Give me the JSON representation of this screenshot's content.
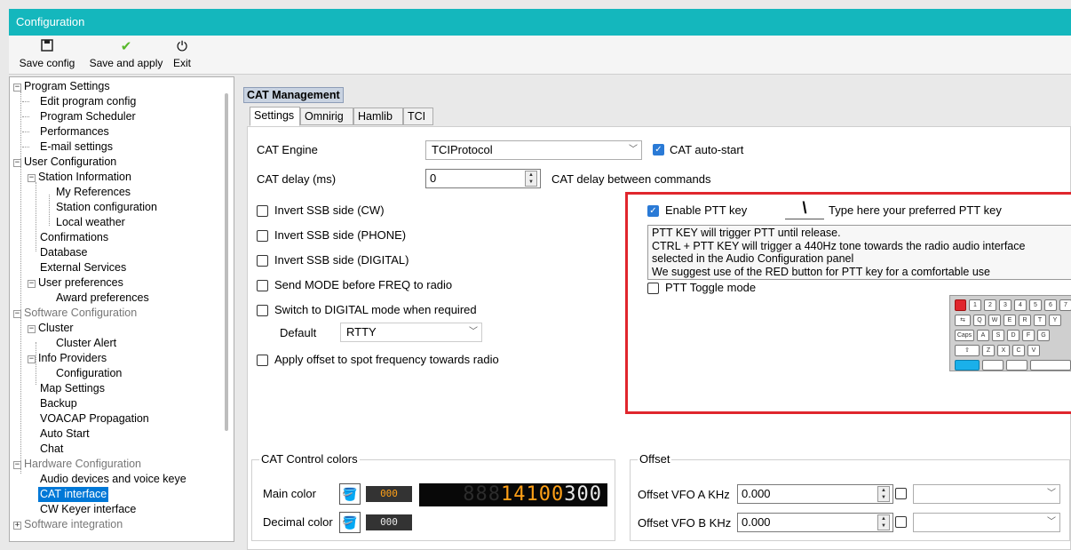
{
  "window": {
    "title": "Configuration"
  },
  "toolbar": {
    "save_config": "Save config",
    "save_and_apply": "Save and apply",
    "exit": "Exit"
  },
  "tree": {
    "items": [
      "Program Settings",
      "Edit program config",
      "Program Scheduler",
      "Performances",
      "E-mail settings",
      "User Configuration",
      "Station Information",
      "My References",
      "Station configuration",
      "Local weather",
      "Confirmations",
      "Database",
      "External Services",
      "User preferences",
      "Award preferences",
      "Software Configuration",
      "Cluster",
      "Cluster Alert",
      "Info Providers",
      "Configuration",
      "Map Settings",
      "Backup",
      "VOACAP Propagation",
      "Auto Start",
      "Chat",
      "Hardware Configuration",
      "Audio devices and voice keye",
      "CAT interface",
      "CW Keyer interface",
      "Software integration"
    ],
    "selected": "CAT interface"
  },
  "section": {
    "title": "CAT Management"
  },
  "tabs": [
    "Settings",
    "Omnirig",
    "Hamlib",
    "TCI"
  ],
  "settings": {
    "cat_engine_label": "CAT Engine",
    "cat_engine_value": "TCIProtocol",
    "cat_autostart_label": "CAT auto-start",
    "cat_delay_label": "CAT delay (ms)",
    "cat_delay_value": "0",
    "cat_delay_hint": "CAT delay between commands",
    "invert_cw": "Invert SSB side (CW)",
    "invert_phone": "Invert SSB side (PHONE)",
    "invert_digital": "Invert SSB side (DIGITAL)",
    "send_mode": "Send MODE before FREQ to radio",
    "switch_digital": "Switch to DIGITAL mode when required",
    "default_label": "Default",
    "default_value": "RTTY",
    "apply_offset": "Apply offset to spot frequency towards radio"
  },
  "ptt": {
    "enable_label": "Enable PTT key",
    "key_value": "\\",
    "key_hint": "Type here your preferred PTT key",
    "info_lines": [
      "PTT KEY will trigger PTT until release.",
      "CTRL + PTT KEY will trigger a 440Hz tone towards the radio audio interface",
      "selected in the Audio Configuration panel",
      "We suggest use of the RED button for PTT key for a comfortable use"
    ],
    "toggle_label": "PTT Toggle mode",
    "highlight_color": "#e0262d"
  },
  "colors": {
    "group_title": "CAT Control colors",
    "main_color_label": "Main color",
    "main_color_value": "000",
    "decimal_color_label": "Decimal color",
    "decimal_color_value": "000",
    "display_dim": "888",
    "display_main": "14100",
    "display_decimal": "300"
  },
  "offset": {
    "group_title": "Offset",
    "vfo_a_label": "Offset VFO A KHz",
    "vfo_a_value": "0.000",
    "vfo_b_label": "Offset VFO B KHz",
    "vfo_b_value": "0.000"
  }
}
